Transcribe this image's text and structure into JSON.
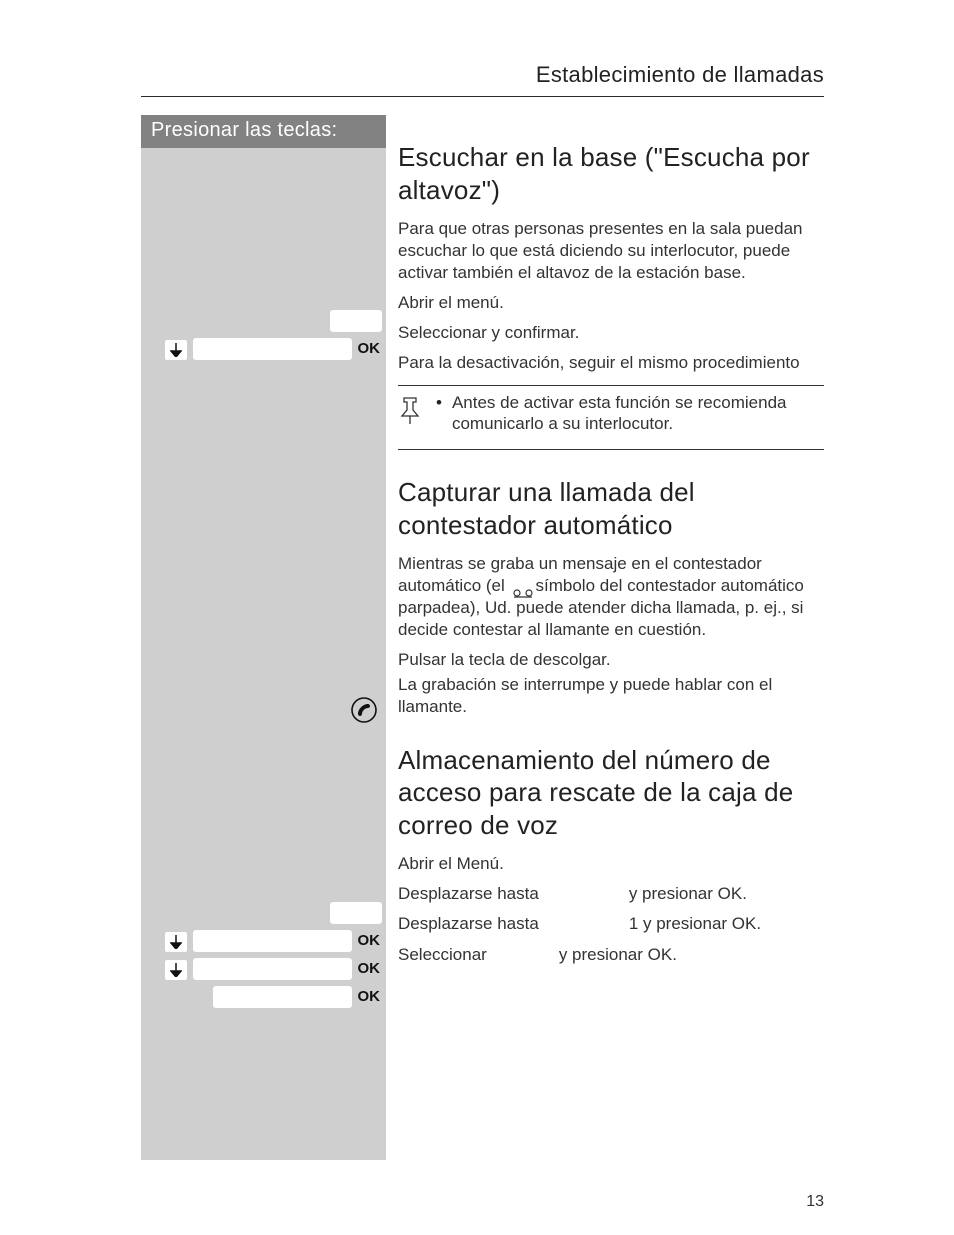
{
  "chapter_title": "Establecimiento de llamadas",
  "left_header": "Presionar las teclas:",
  "ok_label": "OK",
  "section1": {
    "heading": "Escuchar en la base (\"Escucha por altavoz\")",
    "p1": "Para que otras personas presentes en la sala puedan escuchar lo que está diciendo su interlocutor, puede activar también el altavoz de la estación base.",
    "p2": "Abrir el menú.",
    "p3": "Seleccionar y confirmar.",
    "p4": "Para la desactivación, seguir el mismo procedimiento",
    "note": "Antes de activar esta función se recomienda comunicarlo a su interlocutor."
  },
  "section2": {
    "heading": "Capturar una llamada del contestador automático",
    "p1a": "Mientras se graba un mensaje en el contestador automático (el ",
    "p1b": "símbolo del contestador automático parpadea), Ud. puede atender dicha llamada, p. ej., si decide contestar al llamante en cuestión.",
    "p2": "Pulsar la tecla de descolgar.",
    "p3": "La grabación se interrumpe y puede hablar con el llamante."
  },
  "section3": {
    "heading": "Almacenamiento del número de acceso para rescate de la caja de correo de voz",
    "p1": "Abrir el Menú.",
    "p2a": "Desplazarse hasta",
    "p2b": "y presionar OK.",
    "p3a": "Desplazarse hasta",
    "p3b": "1 y presionar OK.",
    "p4a": "Seleccionar",
    "p4b": "y presionar OK."
  },
  "page_number": "13"
}
